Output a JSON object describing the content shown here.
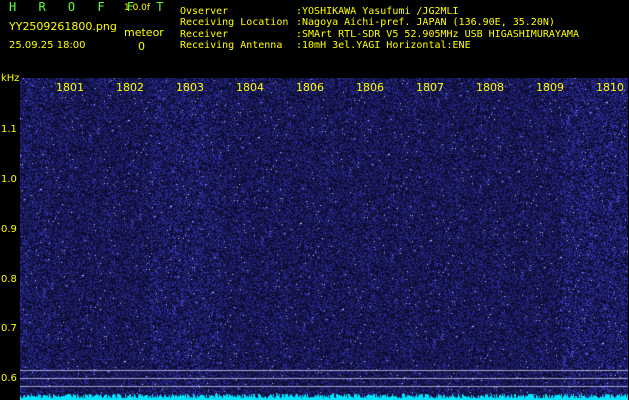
{
  "header": {
    "app_title": "H R O F F T",
    "version": "1.0.0f",
    "filename": "YY2509261800.png",
    "datetime": "25.09.25 18:00",
    "meteor_label": "meteor",
    "meteor_count": "0"
  },
  "info": {
    "labels": [
      "Ovserver",
      "Receiving Location",
      "Receiver",
      "Receiving Antenna"
    ],
    "values": [
      ":YOSHIKAWA Yasufumi /JG2MLI",
      ":Nagoya Aichi-pref. JAPAN (136.90E, 35.20N)",
      ":SMArt RTL-SDR V5 52.905MHz USB HIGASHIMURAYAMA",
      ":10mH 3el.YAGI Horizontal:ENE"
    ]
  },
  "axis": {
    "unit": "kHz",
    "y_ticks": [
      "1.1",
      "1.0",
      "0.9",
      "0.8",
      "0.7",
      "0.6"
    ],
    "x_ticks": [
      "1801",
      "1802",
      "1803",
      "1804",
      "1806",
      "1806",
      "1807",
      "1808",
      "1809",
      "1810"
    ]
  },
  "colors": {
    "background": "#000000",
    "text": "#ffff00",
    "title": "#66ff33",
    "noise": "#1a1a8c",
    "signal_trace": "#00e5ff"
  }
}
